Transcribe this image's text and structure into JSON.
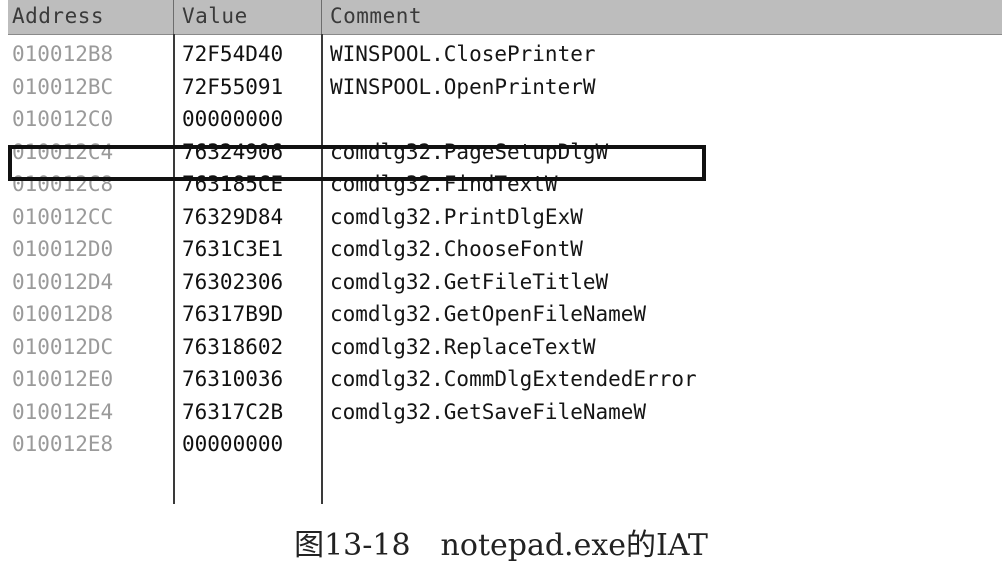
{
  "columns": {
    "address": "Address",
    "value": "Value",
    "comment": "Comment"
  },
  "rows": [
    {
      "address": "010012B8",
      "value": "72F54D40",
      "comment": "WINSPOOL.ClosePrinter"
    },
    {
      "address": "010012BC",
      "value": "72F55091",
      "comment": "WINSPOOL.OpenPrinterW"
    },
    {
      "address": "010012C0",
      "value": "00000000",
      "comment": ""
    },
    {
      "address": "010012C4",
      "value": "76324906",
      "comment": "comdlg32.PageSetupDlgW",
      "highlighted": true
    },
    {
      "address": "010012C8",
      "value": "763185CE",
      "comment": "comdlg32.FindTextW"
    },
    {
      "address": "010012CC",
      "value": "76329D84",
      "comment": "comdlg32.PrintDlgExW"
    },
    {
      "address": "010012D0",
      "value": "7631C3E1",
      "comment": "comdlg32.ChooseFontW"
    },
    {
      "address": "010012D4",
      "value": "76302306",
      "comment": "comdlg32.GetFileTitleW"
    },
    {
      "address": "010012D8",
      "value": "76317B9D",
      "comment": "comdlg32.GetOpenFileNameW"
    },
    {
      "address": "010012DC",
      "value": "76318602",
      "comment": "comdlg32.ReplaceTextW"
    },
    {
      "address": "010012E0",
      "value": "76310036",
      "comment": "comdlg32.CommDlgExtendedError"
    },
    {
      "address": "010012E4",
      "value": "76317C2B",
      "comment": "comdlg32.GetSaveFileNameW"
    },
    {
      "address": "010012E8",
      "value": "00000000",
      "comment": ""
    }
  ],
  "caption": "图13-18　notepad.exe的IAT",
  "colors": {
    "header_bg": "#bdbdbd",
    "address_text": "#9a9a9a",
    "highlight_border": "#111111"
  }
}
